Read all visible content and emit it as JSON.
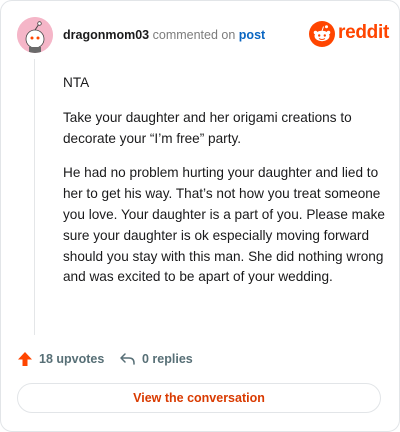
{
  "comment": {
    "username": "dragonmom03",
    "action_text": "commented on",
    "post_link": "post",
    "paragraphs": [
      "NTA",
      "Take your daughter and her origami creations to decorate your “I’m free” party.",
      "He had no problem hurting your daughter and lied to her to get his way. That’s not how you treat someone you love. Your daughter is a part of you. Please make sure your daughter is ok especially moving forward should you stay with this man. She did nothing wrong and was excited to be apart of your wedding."
    ]
  },
  "brand": {
    "logo_text": "reddit",
    "color": "#ff4500"
  },
  "actions": {
    "upvotes_label": "18 upvotes",
    "replies_label": "0 replies"
  },
  "view_button": {
    "label": "View the conversation"
  },
  "icons": {
    "avatar": "snoo-avatar-icon",
    "logo": "reddit-logo-icon",
    "upvote": "upvote-arrow-icon",
    "reply": "reply-arrow-icon"
  }
}
